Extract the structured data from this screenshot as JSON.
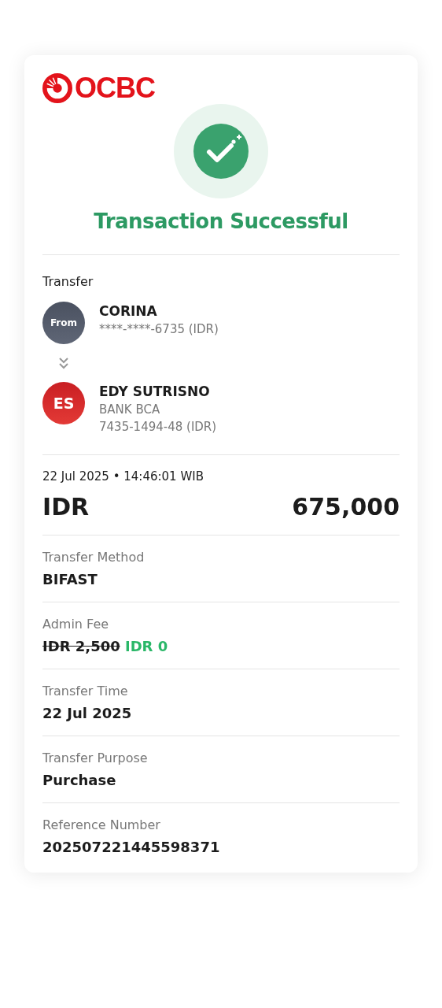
{
  "brand": {
    "name": "OCBC"
  },
  "status": {
    "title": "Transaction Successful"
  },
  "transfer": {
    "label": "Transfer",
    "from": {
      "avatar": "From",
      "name": "CORINA",
      "lines": [
        "****-****-6735 (IDR)"
      ]
    },
    "to": {
      "avatar": "ES",
      "name": "EDY SUTRISNO",
      "lines": [
        "BANK BCA",
        "7435-1494-48 (IDR)"
      ]
    }
  },
  "datetime": "22 Jul 2025 • 14:46:01 WIB",
  "amount": {
    "currency": "IDR",
    "value": "675,000"
  },
  "details": [
    {
      "kind": "plain",
      "label": "Transfer Method",
      "value": "BIFAST"
    },
    {
      "kind": "fee",
      "label": "Admin Fee",
      "old_value": "IDR 2,500",
      "value": "IDR 0"
    },
    {
      "kind": "plain",
      "label": "Transfer Time",
      "value": "22 Jul 2025"
    },
    {
      "kind": "plain",
      "label": "Transfer Purpose",
      "value": "Purchase"
    },
    {
      "kind": "plain",
      "label": "Reference Number",
      "value": "202507221445598371"
    }
  ]
}
